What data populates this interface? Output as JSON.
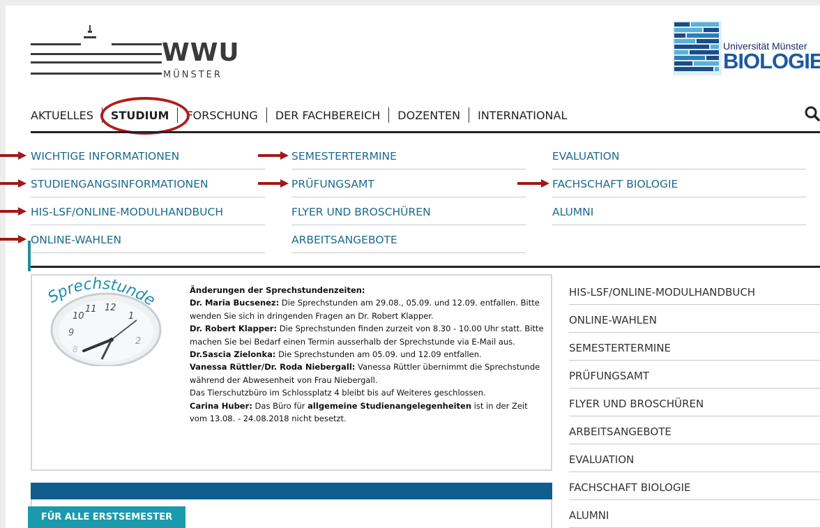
{
  "logos": {
    "wwu_text": "WWU",
    "wwu_sub": "MÜNSTER",
    "bio_uni": "Universität Münster",
    "bio_name": "BIOLOGIE"
  },
  "main_nav": {
    "items": [
      "AKTUELLES",
      "STUDIUM",
      "FORSCHUNG",
      "DER FACHBEREICH",
      "DOZENTEN",
      "INTERNATIONAL"
    ],
    "active": "STUDIUM",
    "search_icon": "search-icon"
  },
  "submenu": {
    "col1": [
      "WICHTIGE INFORMATIONEN",
      "STUDIENGANGSINFORMATIONEN",
      "HIS-LSF/ONLINE-MODULHANDBUCH",
      "ONLINE-WAHLEN"
    ],
    "col2": [
      "SEMESTERTERMINE",
      "PRÜFUNGSAMT",
      "FLYER UND BROSCHÜREN",
      "ARBEITSANGEBOTE"
    ],
    "col3": [
      "EVALUATION",
      "FACHSCHAFT BIOLOGIE",
      "ALUMNI"
    ]
  },
  "sprechstunde": {
    "clock_text": "Sprechstunde",
    "heading": "Änderungen der Sprechstundenzeiten:",
    "p1_name": "Dr. Maria Bucsenez:",
    "p1_text": " Die Sprechstunden am 29.08., 05.09. und 12.09. entfallen. Bitte wenden Sie sich in dringenden Fragen an Dr. Robert Klapper.",
    "p2_name": "Dr. Robert Klapper:",
    "p2_text": " Die Sprechstunden finden zurzeit von 8.30 - 10.00 Uhr statt. Bitte machen Sie bei Bedarf einen Termin ausserhalb der Sprechstunde via E-Mail aus.",
    "p3_name": "Dr.Sascia Zielonka:",
    "p3_text": " Die Sprechstunden am 05.09. und 12.09 entfallen.",
    "p4_name": "Vanessa Rüttler/Dr. Roda Niebergall:",
    "p4_text": " Vanessa Rüttler übernimmt die Sprechstunde während der  Abwesenheit von Frau Niebergall.",
    "p5_text": "Das Tierschutzbüro im Schlossplatz 4 bleibt bis auf Weiteres geschlossen.",
    "p6_name": "Carina Huber:",
    "p6_text_a": " Das Büro für ",
    "p6_bold": "allgemeine Studienangelegenheiten",
    "p6_text_b": " ist in der Zeit vom 13.08. - 24.08.2018 nicht besetzt."
  },
  "erstsemester_button": "FÜR ALLE ERSTSEMESTER",
  "sidebar": {
    "items": [
      "HIS-LSF/ONLINE-MODULHANDBUCH",
      "ONLINE-WAHLEN",
      "SEMESTERTERMINE",
      "PRÜFUNGSAMT",
      "FLYER UND BROSCHÜREN",
      "ARBEITSANGEBOTE",
      "EVALUATION",
      "FACHSCHAFT BIOLOGIE",
      "ALUMNI"
    ]
  },
  "colors": {
    "link": "#1c6a8c",
    "annotation_red": "#a01818",
    "header_blue": "#0f5d8e",
    "button_teal": "#1a9aac"
  }
}
